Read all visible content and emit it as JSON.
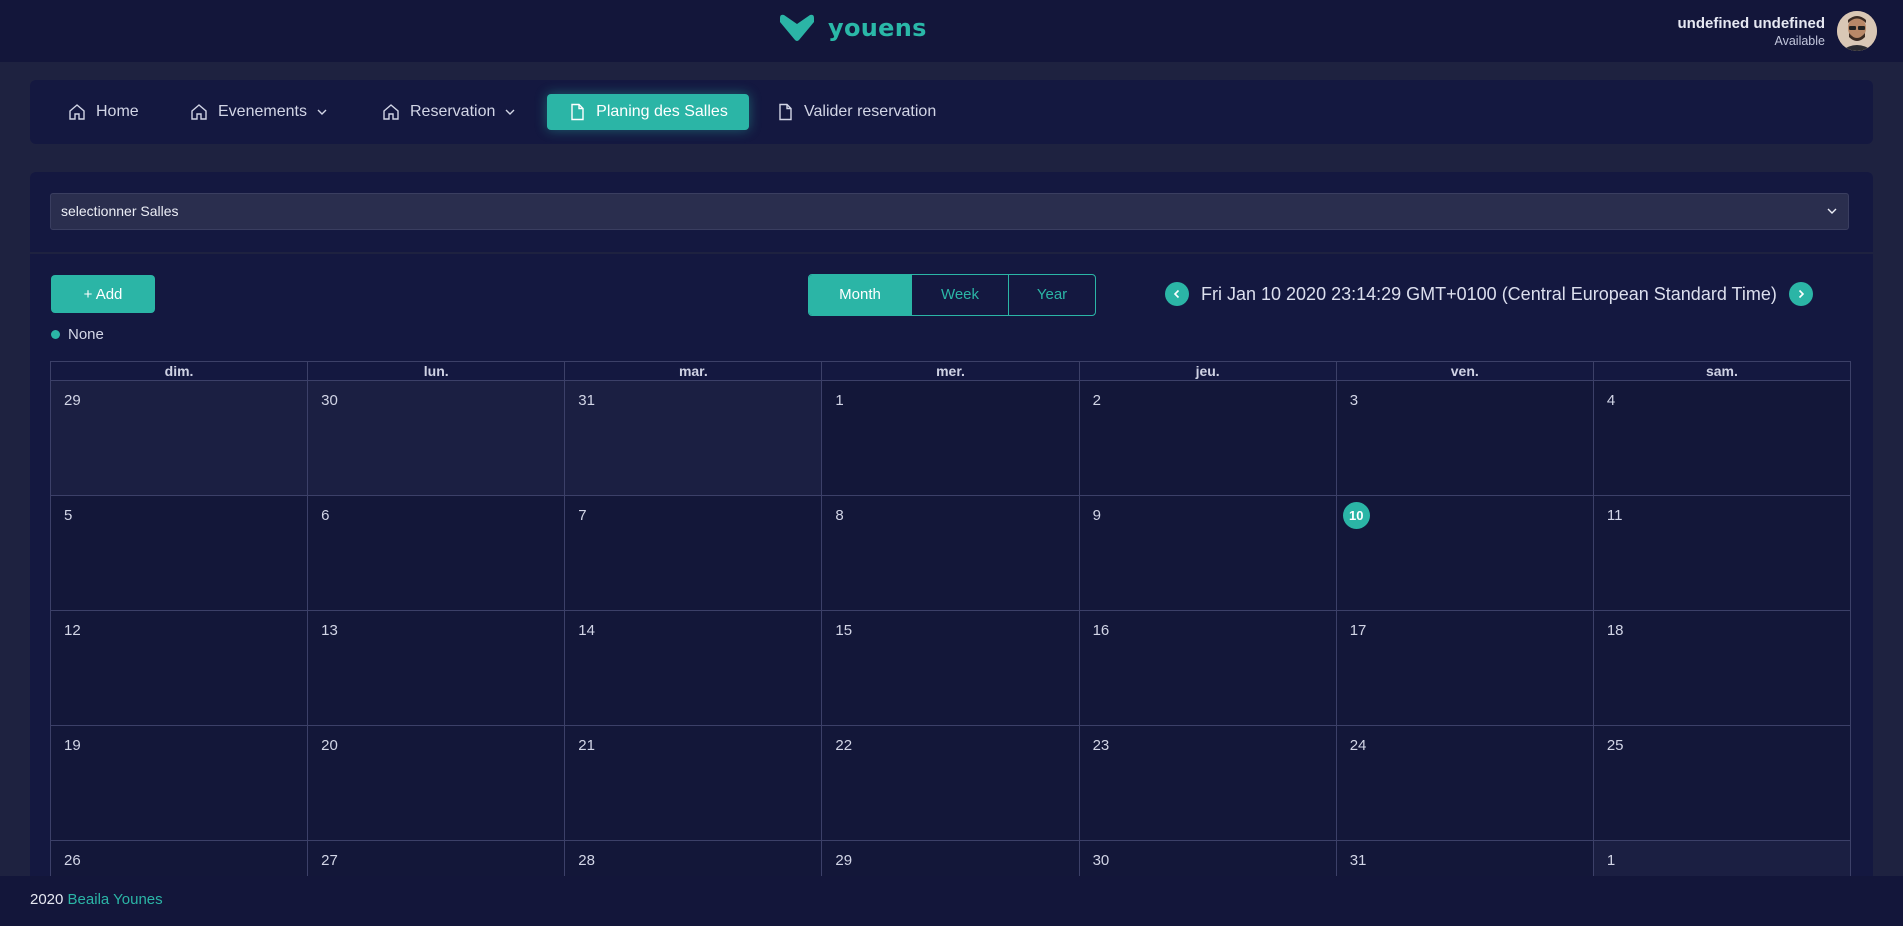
{
  "brand": {
    "name": "youens"
  },
  "user": {
    "name": "undefined undefined",
    "status": "Available"
  },
  "nav": {
    "items": [
      {
        "label": "Home",
        "icon": "home-icon",
        "dropdown": false
      },
      {
        "label": "Evenements",
        "icon": "home-icon",
        "dropdown": true
      },
      {
        "label": "Reservation",
        "icon": "home-icon",
        "dropdown": true
      },
      {
        "label": "Planing des Salles",
        "icon": "document-icon",
        "dropdown": false,
        "active": true
      },
      {
        "label": "Valider reservation",
        "icon": "document-icon",
        "dropdown": false
      }
    ]
  },
  "salles_select": {
    "value": "selectionner Salles"
  },
  "calendar": {
    "add_label": "+ Add",
    "legend": "None",
    "views": [
      "Month",
      "Week",
      "Year"
    ],
    "active_view": "Month",
    "current_date": "Fri Jan 10 2020 23:14:29 GMT+0100 (Central European Standard Time)",
    "weekdays": [
      "dim.",
      "lun.",
      "mar.",
      "mer.",
      "jeu.",
      "ven.",
      "sam."
    ],
    "weeks": [
      [
        "29",
        "30",
        "31",
        "1",
        "2",
        "3",
        "4"
      ],
      [
        "5",
        "6",
        "7",
        "8",
        "9",
        "10",
        "11"
      ],
      [
        "12",
        "13",
        "14",
        "15",
        "16",
        "17",
        "18"
      ],
      [
        "19",
        "20",
        "21",
        "22",
        "23",
        "24",
        "25"
      ],
      [
        "26",
        "27",
        "28",
        "29",
        "30",
        "31",
        "1"
      ]
    ],
    "today": "10"
  },
  "footer": {
    "year": "2020",
    "author": "Beaila Younes"
  },
  "colors": {
    "accent": "#2bb5a6",
    "background": "#1e2240",
    "panel": "#141840"
  }
}
